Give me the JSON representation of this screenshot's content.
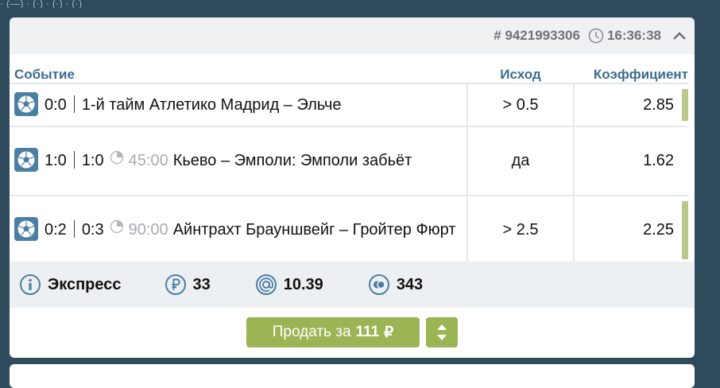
{
  "top_strip_text": "· (—) · (·) · (·) · (·)",
  "card": {
    "bet_id": "# 9421993306",
    "time": "16:36:38",
    "columns": {
      "event": "Событие",
      "outcome": "Исход",
      "coef": "Коэффициент"
    },
    "rows": [
      {
        "score": "0:0",
        "period_score": "1-й тайм",
        "minute": "",
        "match": "Атлетико Мадрид – Эльче",
        "outcome": "> 0.5",
        "coef": "2.85",
        "highlight": true
      },
      {
        "score": "1:0",
        "period_score": "1:0",
        "minute": "45:00",
        "match": "Кьево – Эмполи: Эмполи забьёт",
        "outcome": "да",
        "coef": "1.62",
        "highlight": false
      },
      {
        "score": "0:2",
        "period_score": "0:3",
        "minute": "90:00",
        "match": "Айнтрахт Брауншвейг – Гройтер Фюрт",
        "outcome": "> 2.5",
        "coef": "2.25",
        "highlight": true
      }
    ],
    "summary": {
      "type": "Экспресс",
      "stake": "33",
      "total_coef": "10.39",
      "bonus": "343"
    },
    "sell": {
      "prefix": "Продать за",
      "amount": "111",
      "currency": "₽"
    }
  },
  "colors": {
    "accent_green": "#9bb554",
    "header_blue": "#3b6d8f",
    "background": "#2e4a5b",
    "odds_bar": "#b9c98e"
  },
  "icons": [
    "clock-icon",
    "chevron-up-icon",
    "football-icon",
    "timer-icon",
    "info-icon",
    "ruble-icon",
    "at-icon",
    "coins-icon",
    "sort-arrows-icon"
  ]
}
